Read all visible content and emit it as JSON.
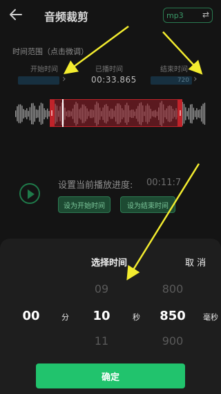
{
  "header": {
    "title": "音频裁剪",
    "format_label": "mp3",
    "swap_glyph": "⇄"
  },
  "time_range": {
    "title": "时间范围（点击微调）",
    "start_label": "开始时间",
    "played_label": "已播时间",
    "end_label": "结束时间",
    "played_value": "00:33.865",
    "end_value_partial": "720"
  },
  "playback": {
    "progress_label": "设置当前播放进度:",
    "progress_value": "00:11:7",
    "set_start_button": "设为开始时间",
    "set_end_button": "设为结束时间"
  },
  "sheet": {
    "title": "选择时间",
    "cancel": "取 消",
    "minute_col": {
      "selected": "00"
    },
    "second_col": {
      "above": "09",
      "selected": "10",
      "below": "11"
    },
    "ms_col": {
      "above": "800",
      "selected": "850",
      "below": "900"
    },
    "unit_min": "分",
    "unit_sec": "秒",
    "unit_ms": "毫秒",
    "confirm": "确定"
  },
  "colors": {
    "accent_green": "#21c36d",
    "selection_red": "#c0232a",
    "arrow_yellow": "#f3ec2f"
  }
}
